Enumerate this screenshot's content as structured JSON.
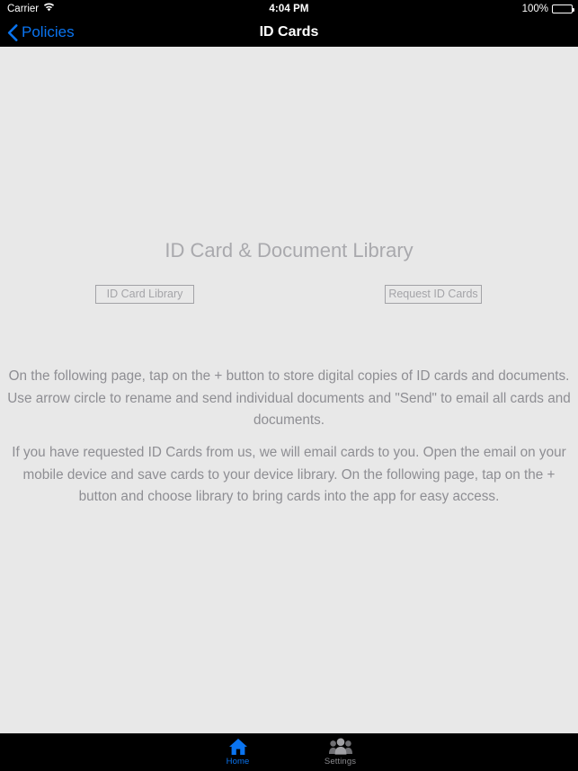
{
  "status_bar": {
    "carrier": "Carrier",
    "wifi_icon": "wifi-icon",
    "time": "4:04 PM",
    "battery_percent": "100%",
    "battery_level": 100
  },
  "nav_bar": {
    "back_label": "Policies",
    "back_icon": "chevron-left-icon",
    "title": "ID Cards"
  },
  "content": {
    "heading": "ID Card & Document Library",
    "buttons": [
      {
        "label": "ID Card Library"
      },
      {
        "label": "Request ID Cards"
      }
    ],
    "paragraphs": [
      "On the following page, tap on the + button to store digital copies of ID cards and documents.  Use arrow circle to rename and send individual documents and \"Send\" to email all cards and documents.",
      "If you have requested ID Cards from us, we will email cards to you.  Open the email on your mobile device and save cards to your device library.  On the following page, tap on the + button and choose library to bring cards into the app for easy access."
    ]
  },
  "tab_bar": {
    "items": [
      {
        "label": "Home",
        "icon": "home-icon",
        "active": true
      },
      {
        "label": "Settings",
        "icon": "people-group-icon",
        "active": false
      }
    ]
  },
  "colors": {
    "accent_blue": "#0a74f0",
    "bar_black": "#000000",
    "content_background": "#e8e8e8",
    "muted_text": "#8e8e93",
    "heading_text": "#a9a9ad",
    "inactive_tab": "#8a8a8e"
  }
}
